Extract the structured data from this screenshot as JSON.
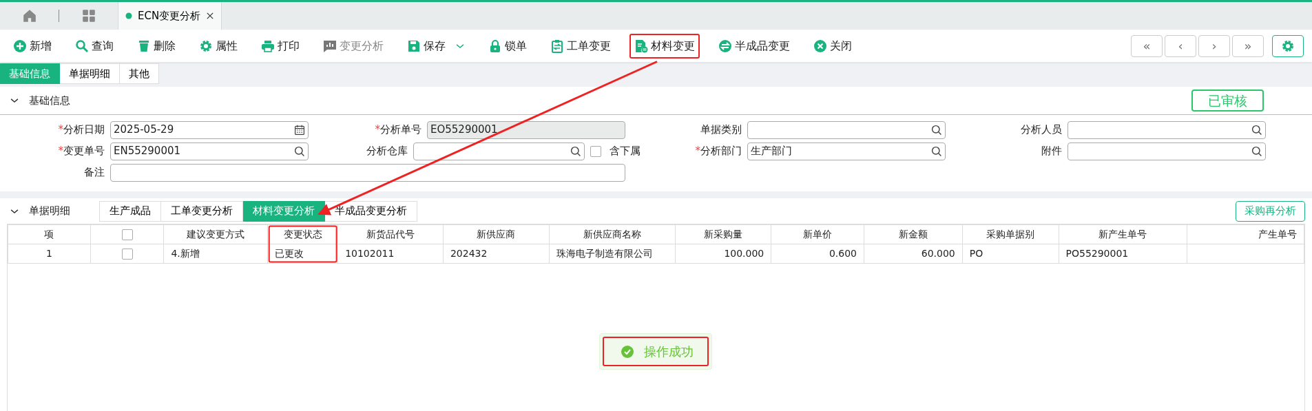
{
  "top_tabs": [
    {
      "selected": false
    },
    {
      "selected": false
    },
    {
      "label": "ECN变更分析",
      "selected": true
    }
  ],
  "toolbar": [
    {
      "label": "新增",
      "disabled": false,
      "highlighted": false
    },
    {
      "label": "查询",
      "disabled": false,
      "highlighted": false
    },
    {
      "label": "删除",
      "disabled": false,
      "highlighted": false
    },
    {
      "label": "属性",
      "disabled": false,
      "highlighted": false
    },
    {
      "label": "打印",
      "disabled": false,
      "highlighted": false
    },
    {
      "label": "变更分析",
      "disabled": true,
      "highlighted": false
    },
    {
      "label": "保存",
      "disabled": false,
      "highlighted": false,
      "dropdown": true
    },
    {
      "label": "锁单",
      "disabled": false,
      "highlighted": false
    },
    {
      "label": "工单变更",
      "disabled": false,
      "highlighted": false
    },
    {
      "label": "材料变更",
      "disabled": false,
      "highlighted": true
    },
    {
      "label": "半成品变更",
      "disabled": false,
      "highlighted": false
    },
    {
      "label": "关闭",
      "disabled": false,
      "highlighted": false
    }
  ],
  "pager": [
    "«",
    "‹",
    "›",
    "»"
  ],
  "sub_tabs": [
    {
      "label": "基础信息",
      "selected": true
    },
    {
      "label": "单据明细",
      "selected": false
    },
    {
      "label": "其他",
      "selected": false
    }
  ],
  "basic_section": {
    "title": "基础信息",
    "expanded": true,
    "status": "已审核"
  },
  "form_rows": [
    [
      {
        "marker": "*",
        "label": "分析日期",
        "kind": "date",
        "value": "2025-05-29"
      },
      {
        "marker": "*",
        "label": "分析单号",
        "kind": "readonly",
        "value": "EO55290001"
      },
      {
        "label": "单据类别",
        "kind": "lookup"
      },
      {
        "label": "分析人员",
        "kind": "lookup"
      }
    ],
    [
      {
        "marker": "*",
        "label": "变更单号",
        "kind": "lookup",
        "value": "EN55290001"
      },
      {
        "label": "分析仓库",
        "kind": "lookup",
        "checkbox": {
          "label": "含下属",
          "checked": false
        }
      },
      {
        "marker": "*",
        "label": "分析部门",
        "kind": "lookup",
        "value": "生产部门"
      },
      {
        "label": "附件",
        "kind": "lookup"
      }
    ],
    [
      {
        "label": "备注",
        "kind": "wide"
      }
    ]
  ],
  "detail_section": {
    "title": "单据明细",
    "expanded": true,
    "action": "采购再分析"
  },
  "detail_tabs": [
    {
      "label": "生产成品",
      "selected": false
    },
    {
      "label": "工单变更分析",
      "selected": false
    },
    {
      "label": "材料变更分析",
      "selected": true
    },
    {
      "label": "半成品变更分析",
      "selected": false
    }
  ],
  "table": {
    "columns": [
      {
        "label": "项"
      },
      {
        "kind": "check",
        "checked": false
      },
      {
        "label": "建议变更方式"
      },
      {
        "label": "变更状态",
        "highlighted": true
      },
      {
        "label": "新货品代号"
      },
      {
        "label": "新供应商"
      },
      {
        "label": "新供应商名称"
      },
      {
        "label": "新采购量"
      },
      {
        "label": "新单价"
      },
      {
        "label": "新金额"
      },
      {
        "label": "采购单据别"
      },
      {
        "label": "新产生单号"
      },
      {
        "label": "产生单号"
      }
    ],
    "rows": [
      {
        "checked": false,
        "cells": [
          "1",
          "",
          "4.新增",
          "已更改",
          "10102011",
          "202432",
          "珠海电子制造有限公司",
          "100.000",
          "0.600",
          "60.000",
          "PO",
          "PO55290001",
          ""
        ]
      }
    ]
  },
  "toast": {
    "text": "操作成功",
    "highlighted": true
  },
  "annotation_arrow": true
}
